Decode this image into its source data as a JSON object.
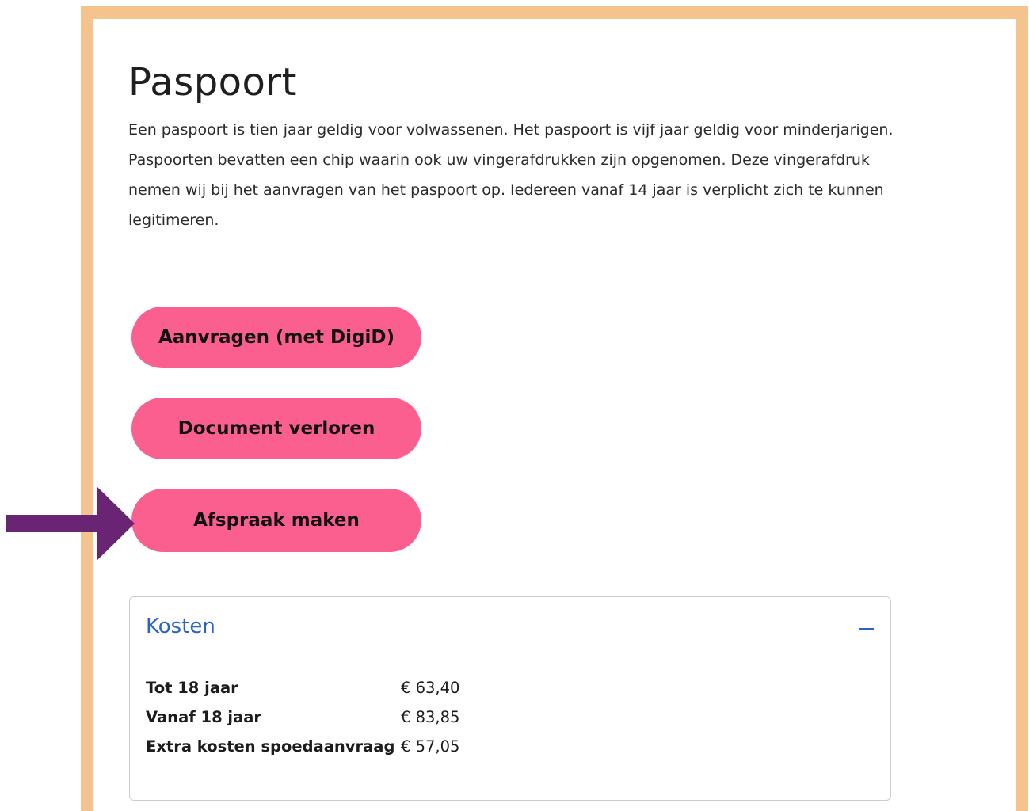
{
  "page": {
    "title": "Paspoort",
    "intro": "Een paspoort is tien jaar geldig voor volwassenen. Het paspoort is vijf jaar geldig voor minderjarigen. Paspoorten bevatten een chip waarin ook uw vingerafdrukken zijn opgenomen. Deze vingerafdruk nemen wij bij het aanvragen van het paspoort op. Iedereen vanaf 14 jaar is verplicht zich te kunnen legitimeren."
  },
  "buttons": {
    "apply_label": "Aanvragen (met DigiD)",
    "lost_label": "Document verloren",
    "appointment_label": "Afspraak maken"
  },
  "costs": {
    "title": "Kosten",
    "toggle_icon": "minus-icon",
    "rows": [
      {
        "label": "Tot 18 jaar",
        "amount": "€ 63,40"
      },
      {
        "label": "Vanaf 18 jaar",
        "amount": "€ 83,85"
      },
      {
        "label": "Extra kosten spoedaanvraag",
        "amount": "€ 57,05"
      }
    ]
  },
  "colors": {
    "frame": "#f5c48e",
    "button": "#fb5f90",
    "accent_blue": "#2a64c0",
    "arrow": "#6a2474"
  },
  "annotation": {
    "icon": "right-arrow-icon"
  }
}
